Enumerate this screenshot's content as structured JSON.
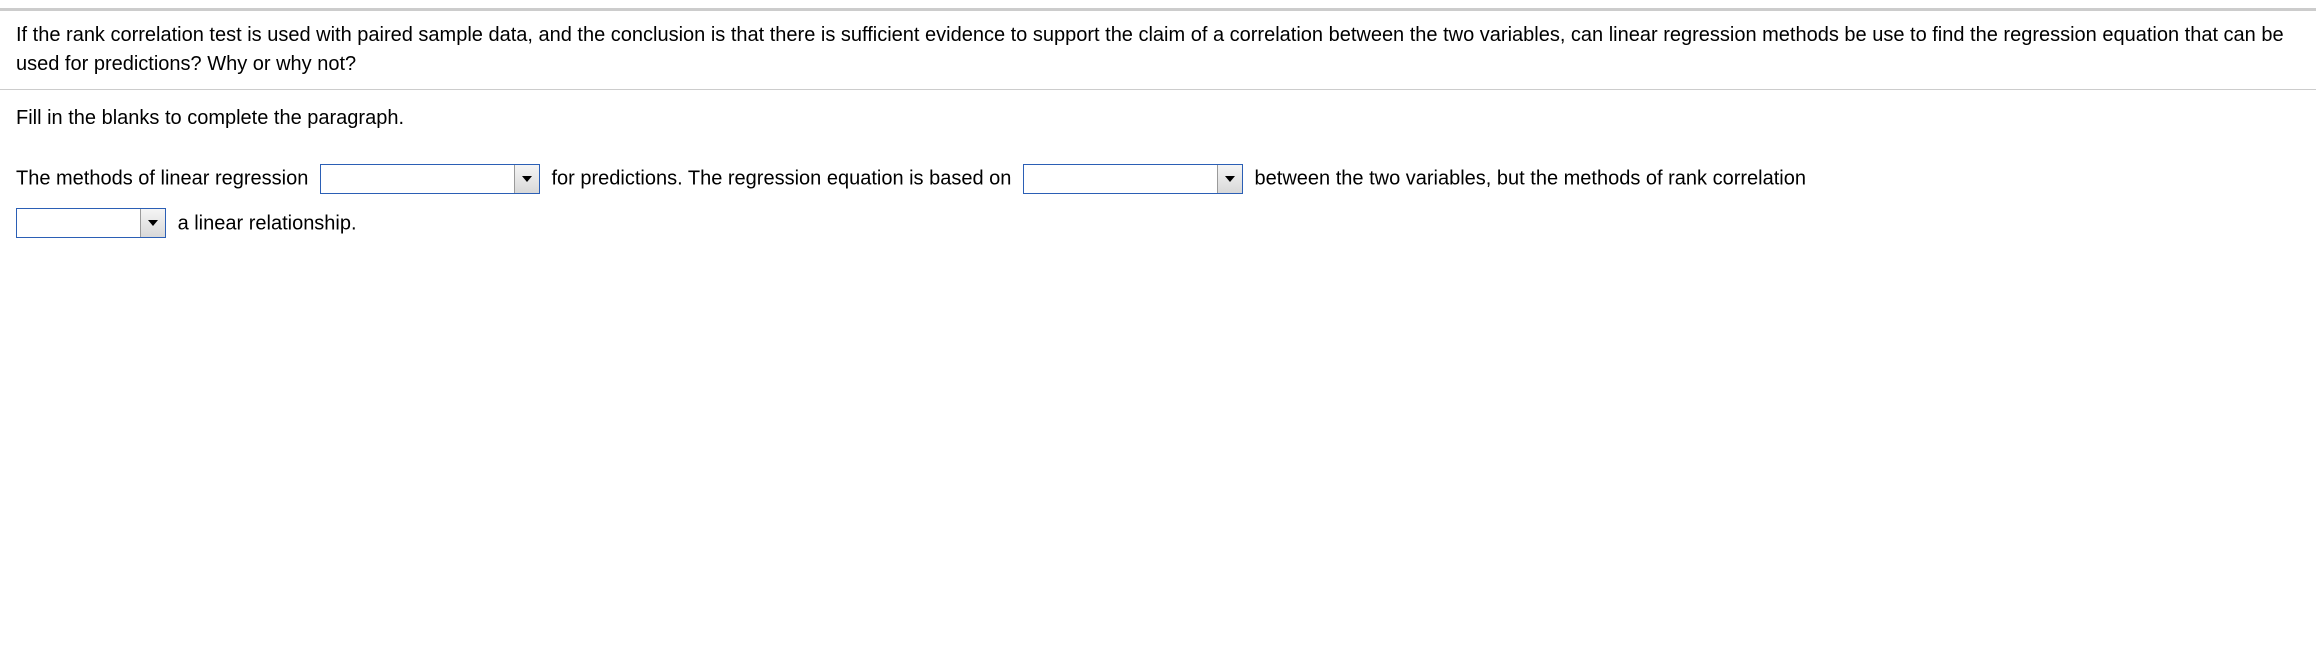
{
  "question": "If the rank correlation test is used with paired sample data, and the conclusion is that there is sufficient evidence to support the claim of a correlation between the two variables, can linear regression methods be use to find the regression equation that can be used for predictions? Why or why not?",
  "answer": {
    "instruction": "Fill in the blanks to complete the paragraph.",
    "segments": {
      "s1": "The methods of linear regression",
      "s2": "for predictions. The regression equation is based on",
      "s3": "between the two variables, but the methods of rank correlation",
      "s4": "a linear relationship."
    },
    "dropdowns": {
      "d1": "",
      "d2": "",
      "d3": ""
    }
  }
}
